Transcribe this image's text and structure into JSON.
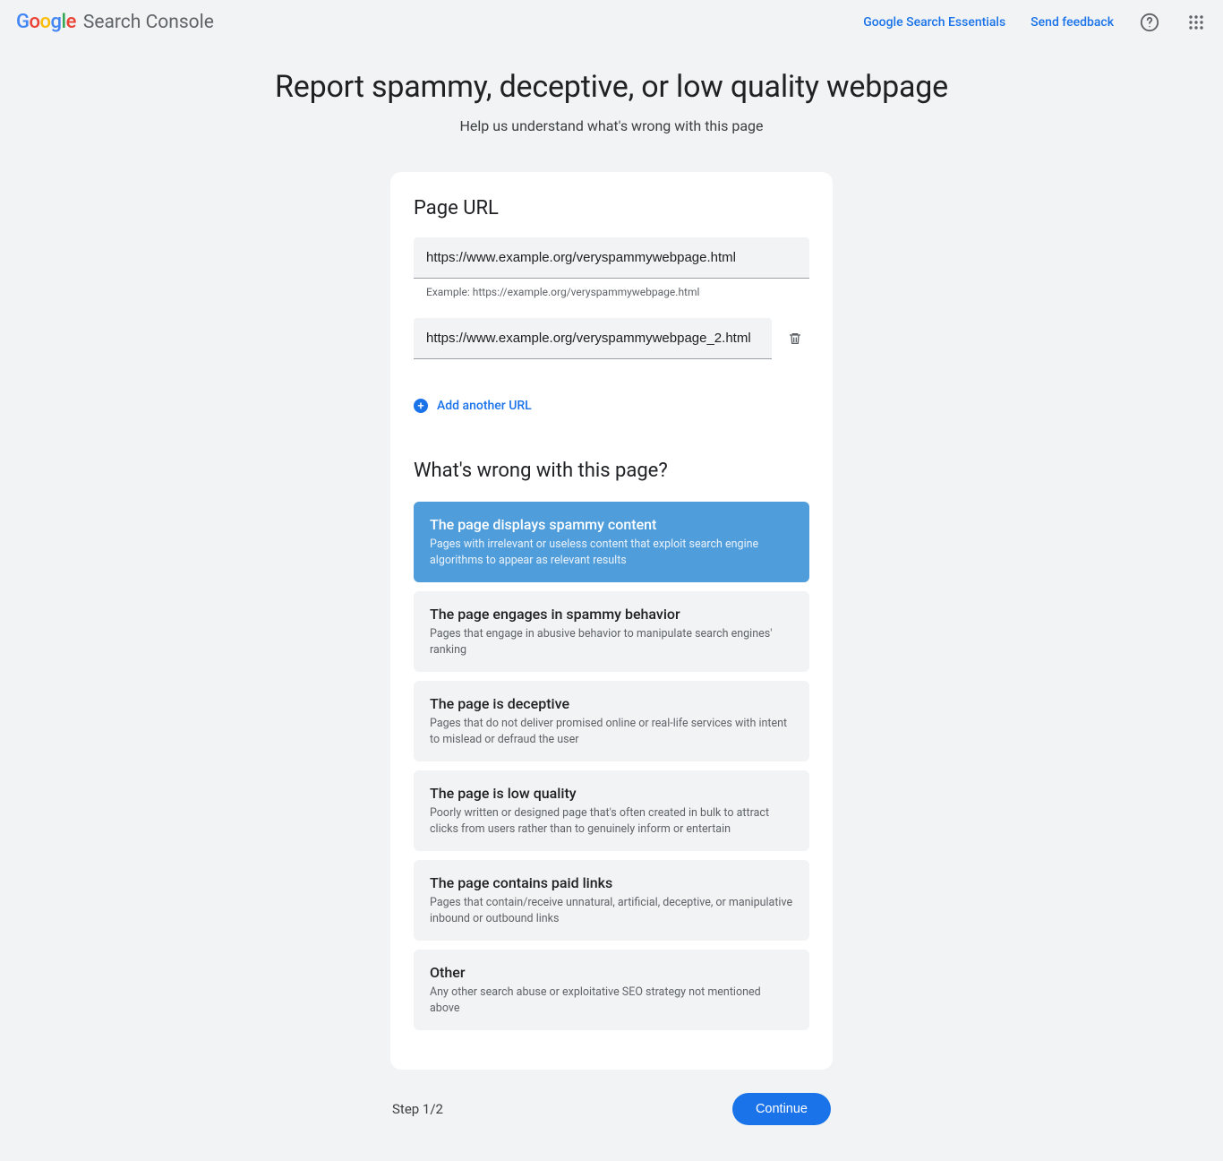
{
  "topbar": {
    "brand_product": "Search Console",
    "link_essentials": "Google Search Essentials",
    "link_feedback": "Send feedback"
  },
  "page": {
    "title": "Report spammy, deceptive, or low quality webpage",
    "subtitle": "Help us understand what's wrong with this page"
  },
  "form": {
    "section_url_title": "Page URL",
    "urls": [
      {
        "value": "https://www.example.org/veryspammywebpage.html"
      },
      {
        "value": "https://www.example.org/veryspammywebpage_2.html"
      }
    ],
    "url_hint": "Example: https://example.org/veryspammywebpage.html",
    "add_url_label": "Add another URL",
    "section_issue_title": "What's wrong with this page?",
    "options": [
      {
        "title": "The page displays spammy content",
        "desc": "Pages with irrelevant or useless content that exploit search engine algorithms to appear as relevant results",
        "selected": true
      },
      {
        "title": "The page engages in spammy behavior",
        "desc": "Pages that engage in abusive behavior to manipulate search engines' ranking",
        "selected": false
      },
      {
        "title": "The page is deceptive",
        "desc": "Pages that do not deliver promised online or real-life services with intent to mislead or defraud the user",
        "selected": false
      },
      {
        "title": "The page is low quality",
        "desc": "Poorly written or designed page that's often created in bulk to attract clicks from users rather than to genuinely inform or entertain",
        "selected": false
      },
      {
        "title": "The page contains paid links",
        "desc": "Pages that contain/receive unnatural, artificial, deceptive, or manipulative inbound or outbound links",
        "selected": false
      },
      {
        "title": "Other",
        "desc": "Any other search abuse or exploitative SEO strategy not mentioned above",
        "selected": false
      }
    ]
  },
  "footer": {
    "step_label": "Step 1/2",
    "continue_label": "Continue"
  }
}
